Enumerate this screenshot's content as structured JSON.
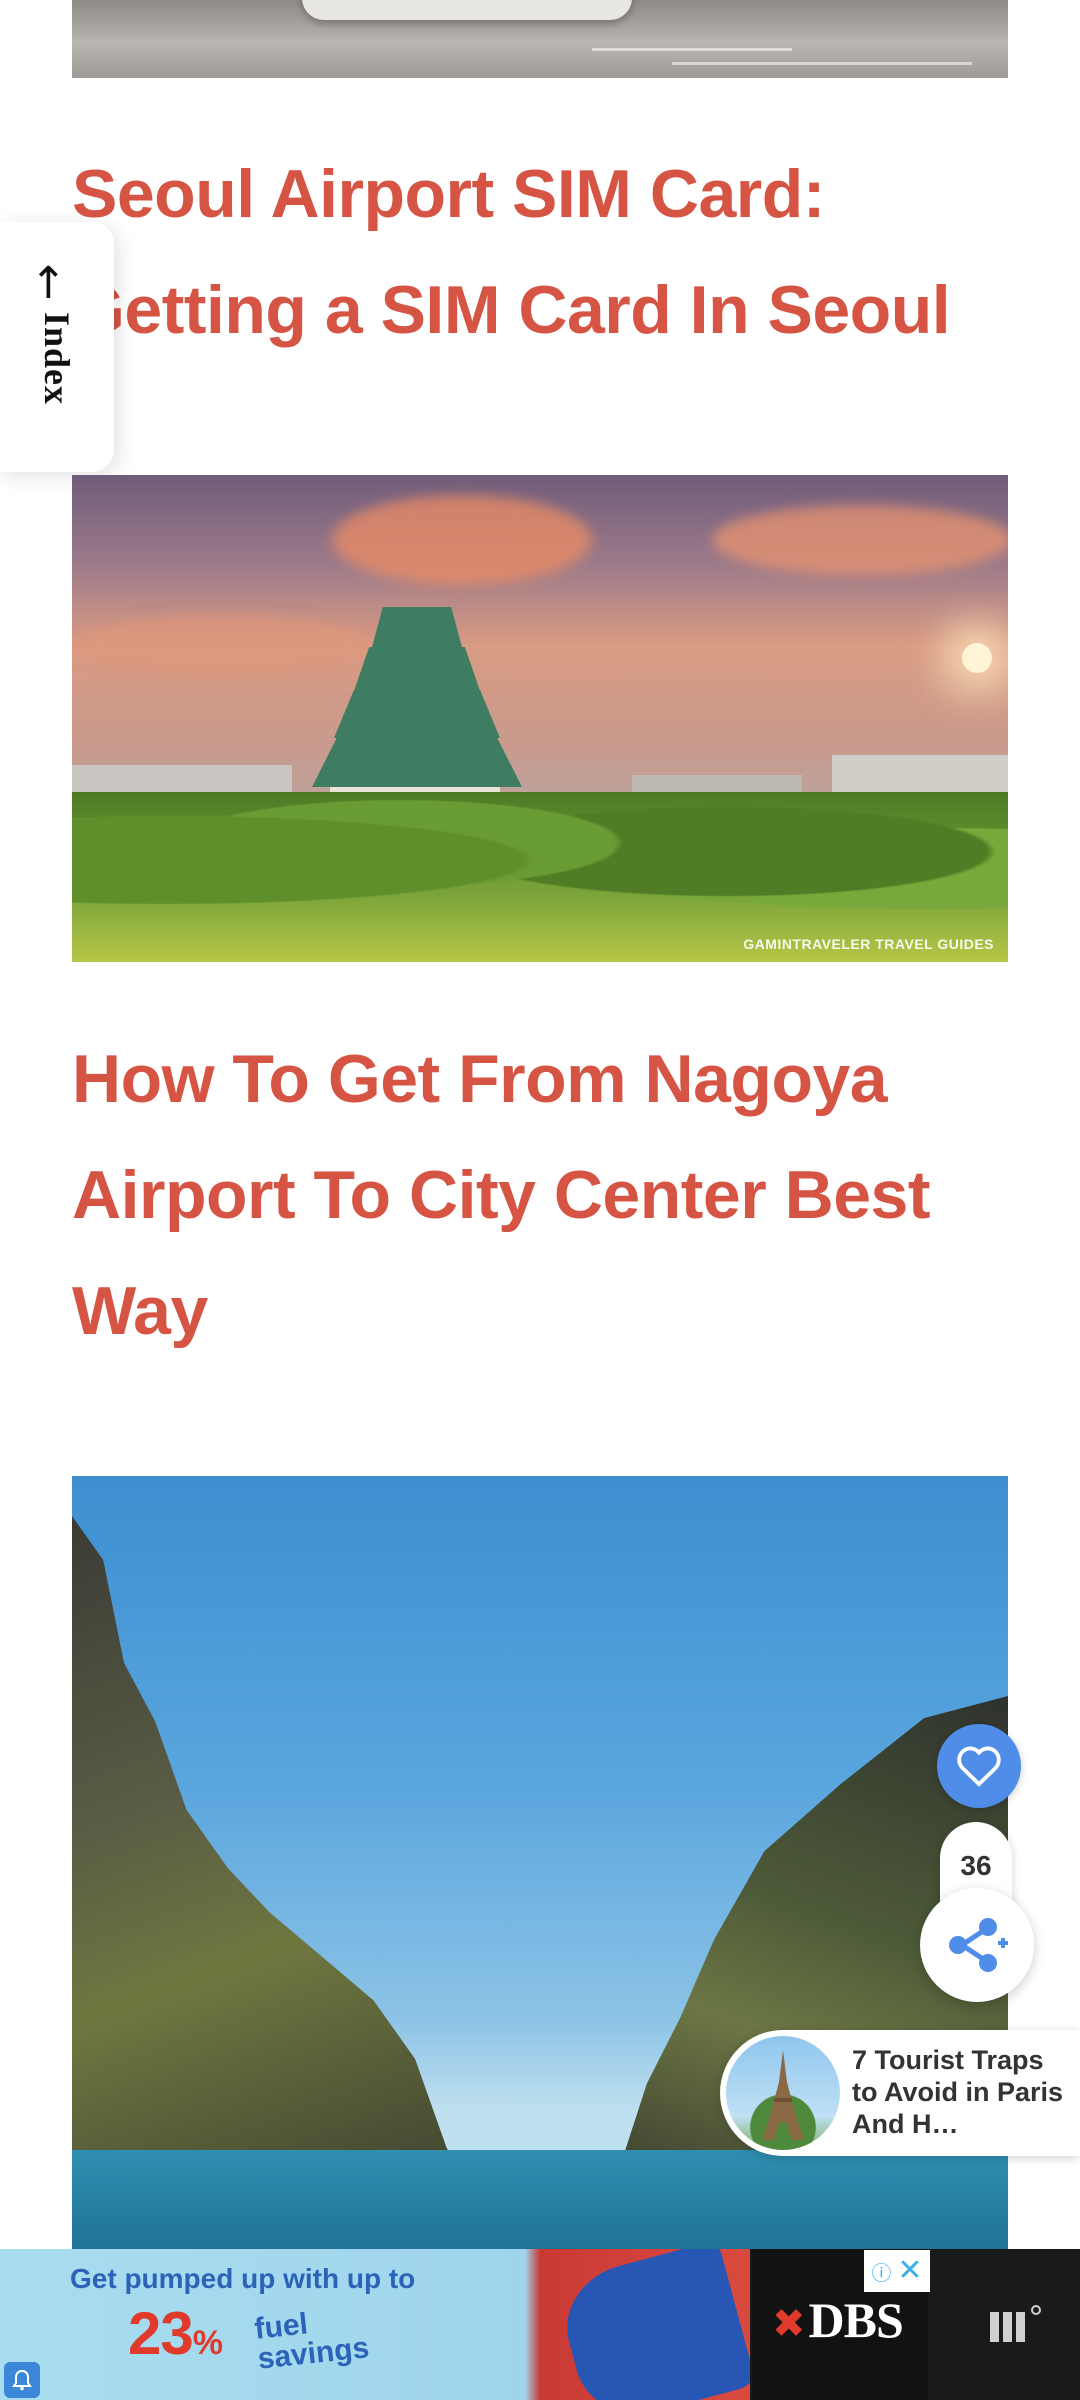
{
  "index_tab": {
    "arrow": "↑",
    "label": "Index"
  },
  "posts": [
    {
      "title_line1": "Seoul Airport SIM Card:",
      "title_line2": "Getting a SIM Card In Seoul"
    },
    {
      "title_line1": "How To Get From Nagoya",
      "title_line2": "Airport To City Center Best",
      "title_line3": "Way",
      "image_credit": "GAMINTRAVELER TRAVEL GUIDES"
    }
  ],
  "share": {
    "count": "36"
  },
  "related": {
    "title": "7 Tourist Traps to Avoid in Paris And H…"
  },
  "ad": {
    "line1": "Get pumped up with up to",
    "percent": "23",
    "percent_sign": "%",
    "fuel_word": "fuel",
    "savings_word": "savings",
    "brand": "DBS",
    "choice_icon": "ad-choices-icon",
    "close_icon": "close-icon"
  },
  "colors": {
    "title": "#d65443",
    "heart": "#4f8de8",
    "share_icon": "#4f8de8"
  }
}
